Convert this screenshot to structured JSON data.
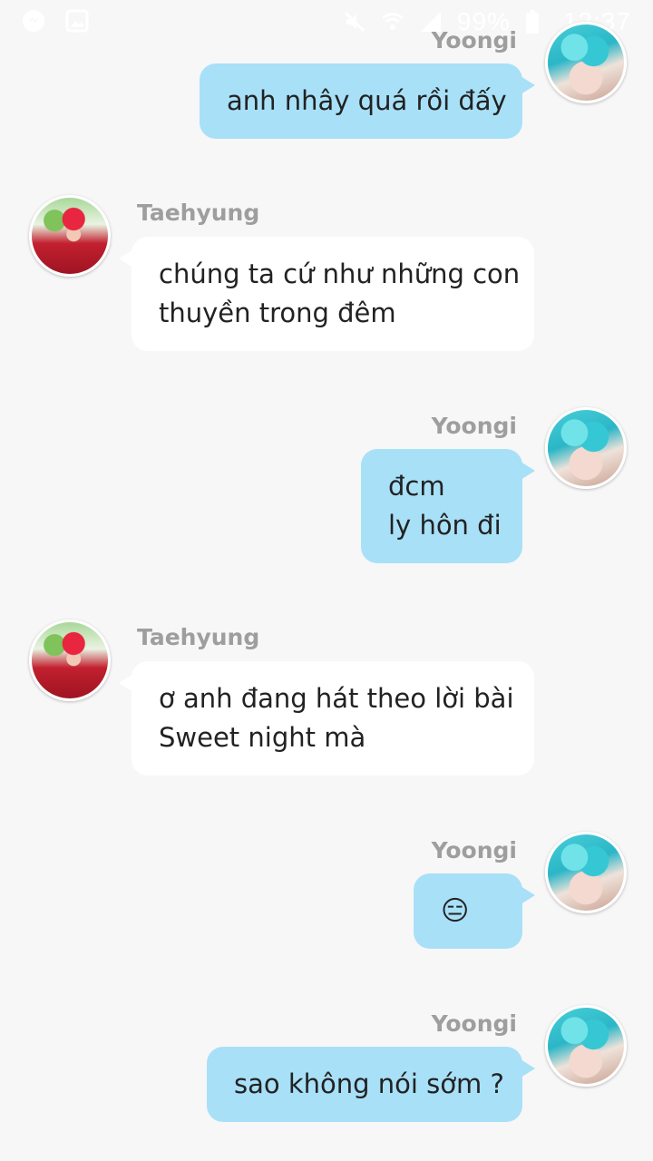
{
  "status_bar": {
    "battery": "99%",
    "time": "12:37"
  },
  "messages": [
    {
      "sender": "Yoongi",
      "side": "right",
      "lines": [
        "anh nhây quá rồi đấy"
      ]
    },
    {
      "sender": "Taehyung",
      "side": "left",
      "lines": [
        "chúng ta cứ như những con",
        "thuyền trong đêm"
      ]
    },
    {
      "sender": "Yoongi",
      "side": "right",
      "lines": [
        "đcm",
        "ly hôn đi"
      ]
    },
    {
      "sender": "Taehyung",
      "side": "left",
      "lines": [
        "ơ anh đang hát theo lời bài",
        "Sweet night mà"
      ]
    },
    {
      "sender": "Yoongi",
      "side": "right",
      "lines": [
        "😑"
      ]
    },
    {
      "sender": "Yoongi",
      "side": "right",
      "lines": [
        "sao không nói sớm ?"
      ]
    }
  ],
  "icons": {
    "status_left": [
      "messenger-icon",
      "image-icon"
    ],
    "status_right": [
      "mute-icon",
      "wifi-icon",
      "signal-icon",
      "battery-icon"
    ]
  },
  "colors": {
    "background": "#f7f7f7",
    "bubble_right": "#a8e0f8",
    "bubble_left": "#ffffff",
    "sender_name": "#9e9e9e"
  }
}
